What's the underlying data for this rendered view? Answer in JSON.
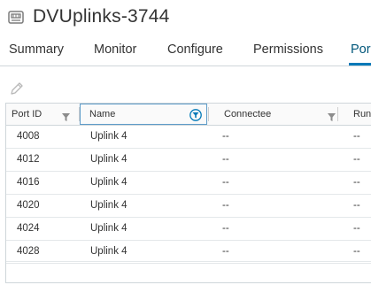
{
  "header": {
    "icon": "distributed-port-group-icon",
    "title": "DVUplinks-3744"
  },
  "tabs": [
    {
      "label": "Summary",
      "active": false
    },
    {
      "label": "Monitor",
      "active": false
    },
    {
      "label": "Configure",
      "active": false
    },
    {
      "label": "Permissions",
      "active": false
    },
    {
      "label": "Por",
      "active": true
    }
  ],
  "toolbar": {
    "edit_icon": "pencil-icon"
  },
  "table": {
    "columns": [
      {
        "label": "Port ID",
        "icon": "filter-icon"
      },
      {
        "label": "Name",
        "icon": "filter-circle-icon"
      },
      {
        "label": "Connectee",
        "icon": "filter-icon"
      },
      {
        "label": "Runt",
        "icon": ""
      }
    ],
    "rows": [
      {
        "port_id": "4008",
        "name": "Uplink 4",
        "connectee": "--",
        "runtime": "--"
      },
      {
        "port_id": "4012",
        "name": "Uplink 4",
        "connectee": "--",
        "runtime": "--"
      },
      {
        "port_id": "4016",
        "name": "Uplink 4",
        "connectee": "--",
        "runtime": "--"
      },
      {
        "port_id": "4020",
        "name": "Uplink 4",
        "connectee": "--",
        "runtime": "--"
      },
      {
        "port_id": "4024",
        "name": "Uplink 4",
        "connectee": "--",
        "runtime": "--"
      },
      {
        "port_id": "4028",
        "name": "Uplink 4",
        "connectee": "--",
        "runtime": "--"
      }
    ]
  },
  "colors": {
    "accent": "#0079b8",
    "active_tab_text": "#00567a",
    "border": "#cfd6da"
  }
}
